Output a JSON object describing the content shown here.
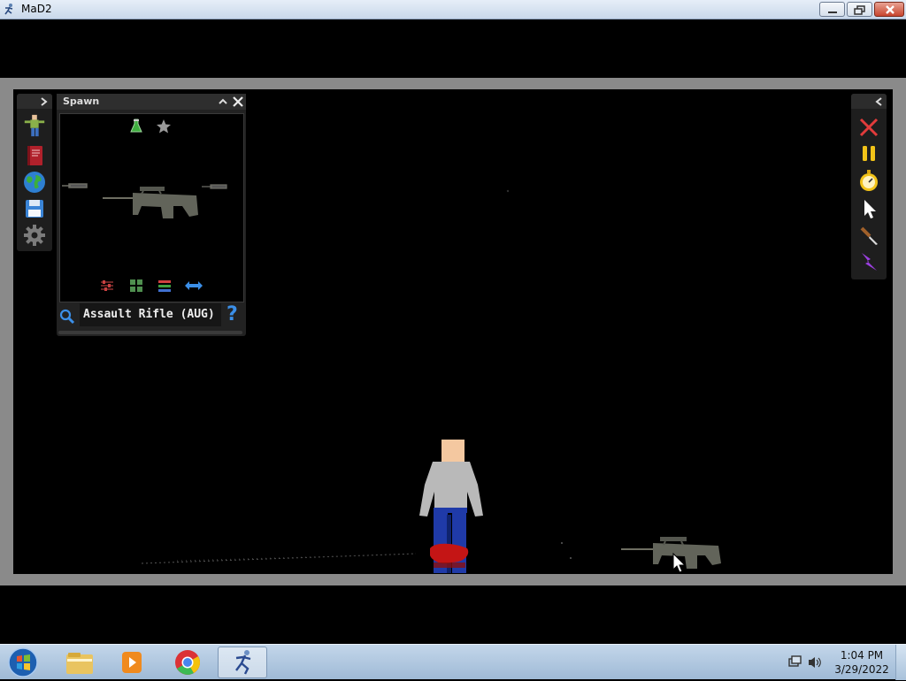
{
  "window": {
    "title": "MaD2"
  },
  "spawn_panel": {
    "title": "Spawn",
    "selected_item": "Assault Rifle (AUG)",
    "help_label": "?"
  },
  "taskbar": {
    "time": "1:04 PM",
    "date": "3/29/2022"
  },
  "colors": {
    "accent_blue": "#3b8fe8",
    "close_red": "#e23b3b",
    "pause_yellow": "#f2c318",
    "blood": "#c41515"
  },
  "icons": {
    "left_rail": [
      "character-icon",
      "book-icon",
      "globe-icon",
      "save-icon",
      "gear-icon"
    ],
    "right_rail": [
      "delete-icon",
      "pause-icon",
      "stopwatch-icon",
      "pointer-icon",
      "knife-icon",
      "lightning-icon"
    ],
    "spawn_tabs": [
      "flask-icon",
      "star-icon"
    ],
    "spawn_tools": [
      "sliders-icon",
      "grid-icon",
      "list-icon",
      "swap-icon"
    ]
  }
}
